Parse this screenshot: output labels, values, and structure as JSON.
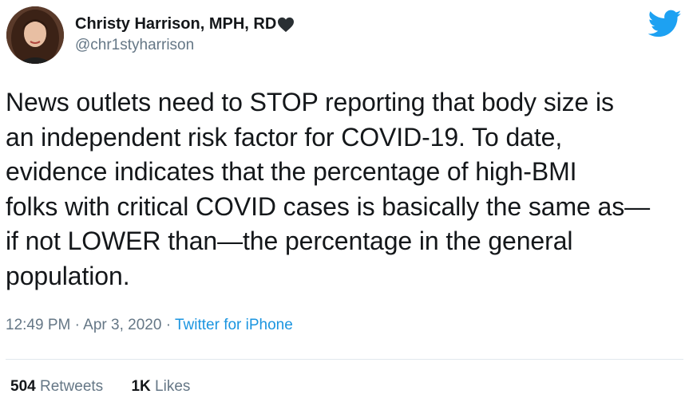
{
  "author": {
    "display_name": "Christy Harrison, MPH, RD",
    "handle": "@chr1styharrison",
    "badge_icon": "black-heart-icon"
  },
  "brand": {
    "icon": "twitter-bird-icon",
    "color": "#1da1f2"
  },
  "tweet": {
    "lines": [
      "News outlets need to STOP reporting that body size is",
      "an independent risk factor for COVID-19. To date,",
      "evidence indicates that the percentage of high-BMI",
      "folks with critical COVID cases is basically the same as—",
      "if not LOWER than—the percentage in the general",
      "population."
    ]
  },
  "meta": {
    "time": "12:49 PM",
    "separator": " · ",
    "date": "Apr 3, 2020",
    "source": "Twitter for iPhone"
  },
  "stats": {
    "retweets_count": "504",
    "retweets_label": "Retweets",
    "likes_count": "1K",
    "likes_label": "Likes"
  },
  "colors": {
    "text": "#14171a",
    "secondary": "#657786",
    "link": "#1b95e0",
    "divider": "#e1e8ed"
  }
}
